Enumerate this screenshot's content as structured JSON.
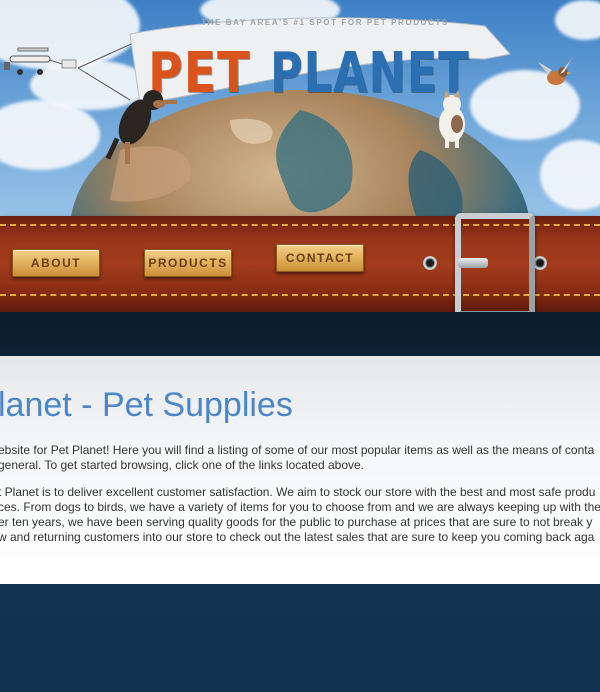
{
  "header": {
    "tagline": "THE BAY AREA'S #1 SPOT FOR PET PRODUCTS",
    "logo_pet": "PET",
    "logo_planet": "PLANET"
  },
  "nav": {
    "about": "ABOUT",
    "products": "PRODUCTS",
    "contact": "CONTACT"
  },
  "main": {
    "title": "lanet - Pet Supplies",
    "paragraph1": [
      "ebsite for Pet Planet! Here you will find a listing of some of our most popular items as well as the means of conta",
      "general. To get started browsing, click one of the links located above."
    ],
    "paragraph2": [
      "t Planet is to deliver excellent customer satisfaction. We aim to stock our store with the best and most safe produ",
      "ces. From dogs to birds, we have a variety of items for you to choose from and we are always keeping up with the",
      "er ten years, we have been serving quality goods for the public to purchase at prices that are sure to not break y",
      "w and returning customers into our store to check out the latest sales that are sure to keep you coming back aga"
    ]
  },
  "colors": {
    "title_blue": "#4c86c8",
    "logo_orange": "#d9541c",
    "logo_blue": "#2b6fb2",
    "collar_leather": "#9a3618",
    "button_gold": "#e2b15c"
  }
}
